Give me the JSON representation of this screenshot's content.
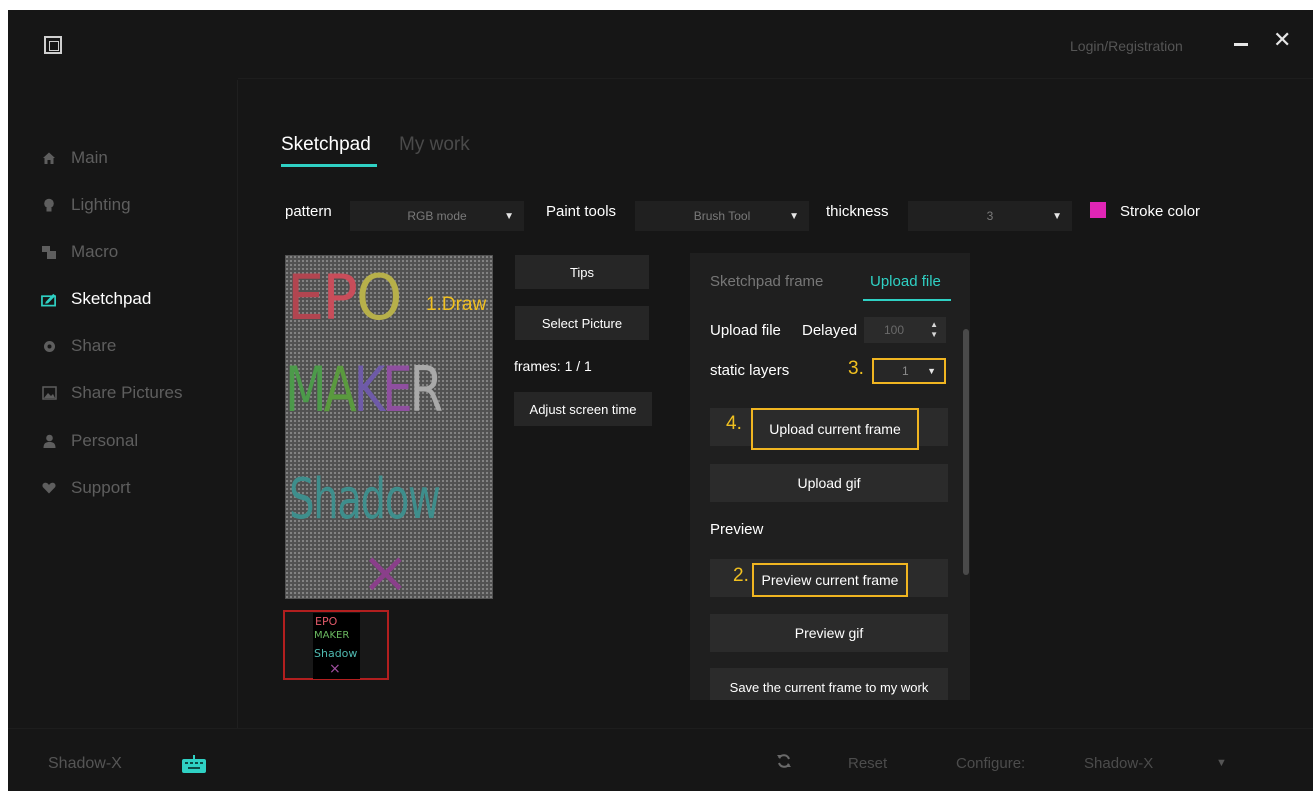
{
  "window": {
    "login": "Login/Registration",
    "minimize_icon": "minimize-icon",
    "close_glyph": "✕"
  },
  "sidebar": {
    "items": [
      {
        "label": "Main",
        "icon": "home-icon"
      },
      {
        "label": "Lighting",
        "icon": "bulb-icon"
      },
      {
        "label": "Macro",
        "icon": "macro-icon"
      },
      {
        "label": "Sketchpad",
        "icon": "sketchpad-icon",
        "active": true
      },
      {
        "label": "Share",
        "icon": "share-icon"
      },
      {
        "label": "Share Pictures",
        "icon": "picture-icon"
      },
      {
        "label": "Personal",
        "icon": "person-icon"
      },
      {
        "label": "Support",
        "icon": "heart-icon"
      }
    ]
  },
  "tabs": {
    "sketchpad": "Sketchpad",
    "my_work": "My work"
  },
  "toolbar": {
    "pattern_label": "pattern",
    "pattern_value": "RGB mode",
    "paint_label": "Paint tools",
    "paint_value": "Brush Tool",
    "thickness_label": "thickness",
    "thickness_value": "3",
    "stroke_label": "Stroke color",
    "stroke_color": "#e025b5"
  },
  "canvas": {
    "line1": "EPO",
    "line2": "MAKER",
    "line3": "Shadow",
    "line4": "×",
    "annotation": "1.Draw",
    "accent": "#f0c020"
  },
  "middle": {
    "tips": "Tips",
    "select_picture": "Select Picture",
    "frames": "frames: 1 / 1",
    "adjust": "Adjust screen time"
  },
  "panel": {
    "tab_sketchpad_frame": "Sketchpad frame",
    "tab_upload_file": "Upload file",
    "upload_label": "Upload file",
    "delayed_label": "Delayed",
    "delay_value": "100",
    "static_layers_label": "static layers",
    "static_layers_value": "1",
    "annot3": "3.",
    "annot4": "4.",
    "annot2": "2.",
    "upload_current_frame": "Upload current frame",
    "upload_gif": "Upload gif",
    "preview_label": "Preview",
    "preview_current_frame": "Preview current frame",
    "preview_gif": "Preview gif",
    "save_frame": "Save the current frame to my work",
    "accent": "#2fd1c4",
    "highlight": "#f0b521"
  },
  "footer": {
    "device": "Shadow-X",
    "reset": "Reset",
    "configure": "Configure:",
    "config_value": "Shadow-X"
  }
}
